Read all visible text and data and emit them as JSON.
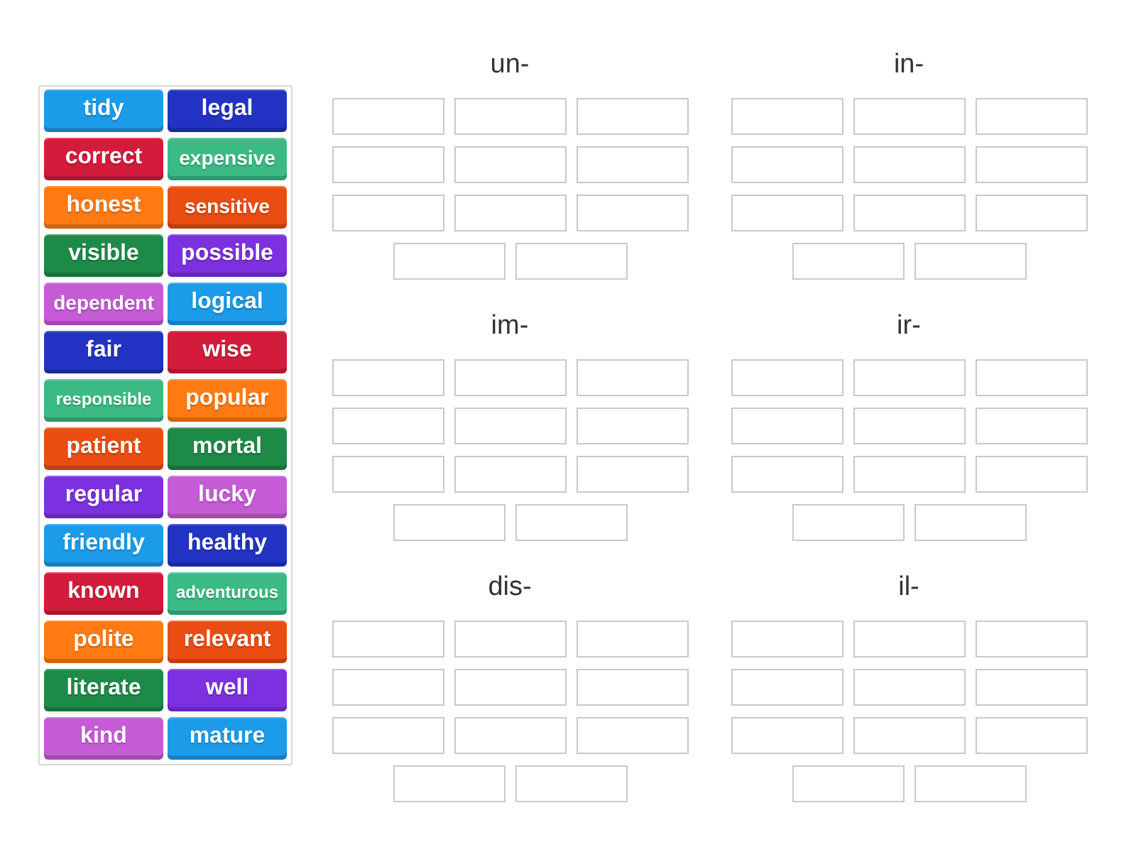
{
  "tiles": [
    {
      "label": "tidy",
      "color": "#1c9be8"
    },
    {
      "label": "legal",
      "color": "#2233c4"
    },
    {
      "label": "correct",
      "color": "#d31c3c"
    },
    {
      "label": "expensive",
      "color": "#3cba86"
    },
    {
      "label": "honest",
      "color": "#ff7a12"
    },
    {
      "label": "sensitive",
      "color": "#ea4d12"
    },
    {
      "label": "visible",
      "color": "#1d8a48"
    },
    {
      "label": "possible",
      "color": "#7c30e0"
    },
    {
      "label": "dependent",
      "color": "#c65bd6"
    },
    {
      "label": "logical",
      "color": "#1c9be8"
    },
    {
      "label": "fair",
      "color": "#2233c4"
    },
    {
      "label": "wise",
      "color": "#d31c3c"
    },
    {
      "label": "responsible",
      "color": "#3cba86"
    },
    {
      "label": "popular",
      "color": "#ff7a12"
    },
    {
      "label": "patient",
      "color": "#ea4d12"
    },
    {
      "label": "mortal",
      "color": "#1d8a48"
    },
    {
      "label": "regular",
      "color": "#7c30e0"
    },
    {
      "label": "lucky",
      "color": "#c65bd6"
    },
    {
      "label": "friendly",
      "color": "#1c9be8"
    },
    {
      "label": "healthy",
      "color": "#2233c4"
    },
    {
      "label": "known",
      "color": "#d31c3c"
    },
    {
      "label": "adventurous",
      "color": "#3cba86"
    },
    {
      "label": "polite",
      "color": "#ff7a12"
    },
    {
      "label": "relevant",
      "color": "#ea4d12"
    },
    {
      "label": "literate",
      "color": "#1d8a48"
    },
    {
      "label": "well",
      "color": "#7c30e0"
    },
    {
      "label": "kind",
      "color": "#c65bd6"
    },
    {
      "label": "mature",
      "color": "#1c9be8"
    }
  ],
  "groups": [
    {
      "title": "un-"
    },
    {
      "title": "in-"
    },
    {
      "title": "im-"
    },
    {
      "title": "ir-"
    },
    {
      "title": "dis-"
    },
    {
      "title": "il-"
    }
  ]
}
